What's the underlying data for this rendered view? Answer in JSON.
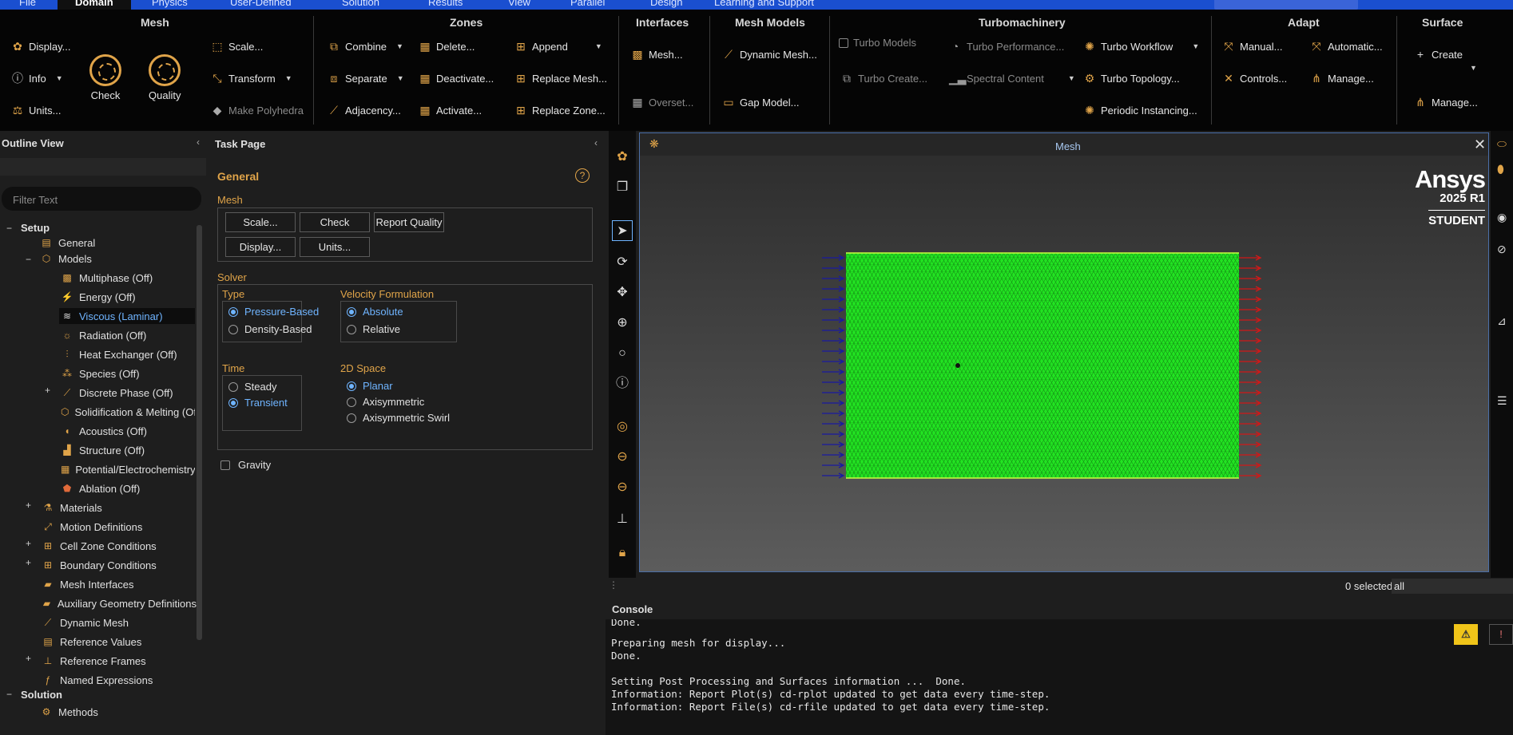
{
  "menubar": {
    "items": [
      {
        "label": "File"
      },
      {
        "label": "Domain"
      },
      {
        "label": "Physics"
      },
      {
        "label": "User-Defined"
      },
      {
        "label": "Solution"
      },
      {
        "label": "Results"
      },
      {
        "label": "View"
      },
      {
        "label": "Parallel"
      },
      {
        "label": "Design"
      },
      {
        "label": "Learning and Support"
      }
    ]
  },
  "ribbon": {
    "groups": {
      "mesh": "Mesh",
      "zones": "Zones",
      "interfaces": "Interfaces",
      "mesh_models": "Mesh Models",
      "turbomachinery": "Turbomachinery",
      "adapt": "Adapt",
      "surface": "Surface"
    },
    "mesh": {
      "display": "Display...",
      "info": "Info",
      "units": "Units...",
      "check": "Check",
      "quality": "Quality",
      "scale": "Scale...",
      "transform": "Transform",
      "make_polyhedra": "Make Polyhedra"
    },
    "zones": {
      "combine": "Combine",
      "separate": "Separate",
      "adjacency": "Adjacency...",
      "delete": "Delete...",
      "deactivate": "Deactivate...",
      "activate": "Activate...",
      "append": "Append",
      "replace_mesh": "Replace Mesh...",
      "replace_zone": "Replace Zone..."
    },
    "interfaces": {
      "mesh": "Mesh...",
      "overset": "Overset..."
    },
    "mesh_models": {
      "dynamic_mesh": "Dynamic Mesh...",
      "gap_model": "Gap Model..."
    },
    "turbo": {
      "turbo_models": "Turbo Models",
      "turbo_performance": "Turbo Performance...",
      "turbo_workflow": "Turbo Workflow",
      "turbo_create": "Turbo Create...",
      "spectral_content": "Spectral Content",
      "turbo_topology": "Turbo Topology...",
      "periodic_instancing": "Periodic Instancing..."
    },
    "adapt": {
      "manual": "Manual...",
      "automatic": "Automatic...",
      "controls": "Controls...",
      "manage": "Manage..."
    },
    "surface": {
      "create": "Create",
      "manage": "Manage..."
    }
  },
  "outline": {
    "title": "Outline View",
    "filter_placeholder": "Filter Text",
    "setup": "Setup",
    "general": "General",
    "models": "Models",
    "model_items": [
      "Multiphase (Off)",
      "Energy (Off)",
      "Viscous (Laminar)",
      "Radiation (Off)",
      "Heat Exchanger (Off)",
      "Species (Off)",
      "Discrete Phase (Off)",
      "Solidification & Melting (Off)",
      "Acoustics (Off)",
      "Structure (Off)",
      "Potential/Electrochemistry (Off)",
      "Ablation (Off)"
    ],
    "setup_items": [
      "Materials",
      "Motion Definitions",
      "Cell Zone Conditions",
      "Boundary Conditions",
      "Mesh Interfaces",
      "Auxiliary Geometry Definitions",
      "Dynamic Mesh",
      "Reference Values",
      "Reference Frames",
      "Named Expressions"
    ],
    "solution": "Solution",
    "solution_items": [
      "Methods"
    ]
  },
  "task": {
    "title": "Task Page",
    "heading": "General",
    "mesh_label": "Mesh",
    "buttons": {
      "scale": "Scale...",
      "check": "Check",
      "report_quality": "Report Quality",
      "display": "Display...",
      "units": "Units..."
    },
    "solver_label": "Solver",
    "type_label": "Type",
    "type_options": [
      "Pressure-Based",
      "Density-Based"
    ],
    "type_selected": "Pressure-Based",
    "velocity_label": "Velocity Formulation",
    "velocity_options": [
      "Absolute",
      "Relative"
    ],
    "velocity_selected": "Absolute",
    "time_label": "Time",
    "time_options": [
      "Steady",
      "Transient"
    ],
    "time_selected": "Transient",
    "space_label": "2D Space",
    "space_options": [
      "Planar",
      "Axisymmetric",
      "Axisymmetric Swirl"
    ],
    "space_selected": "Planar",
    "gravity_label": "Gravity",
    "help": "?"
  },
  "graphics": {
    "tab_title": "Mesh",
    "brand": "Ansys",
    "version": "2025 R1",
    "edition": "STUDENT",
    "selection_count": "0 selected",
    "selection_filter": "all",
    "mesh_fill_color": "#22e422",
    "inlet_color": "#1a1aa0",
    "outlet_color": "#d01818"
  },
  "console": {
    "title": "Console",
    "lines": [
      "Done.",
      "",
      "Preparing mesh for display...",
      "Done.",
      "",
      "Setting Post Processing and Surfaces information ...  Done.",
      "Information: Report Plot(s) cd-rplot updated to get data every time-step.",
      "Information: Report File(s) cd-rfile updated to get data every time-step."
    ]
  }
}
